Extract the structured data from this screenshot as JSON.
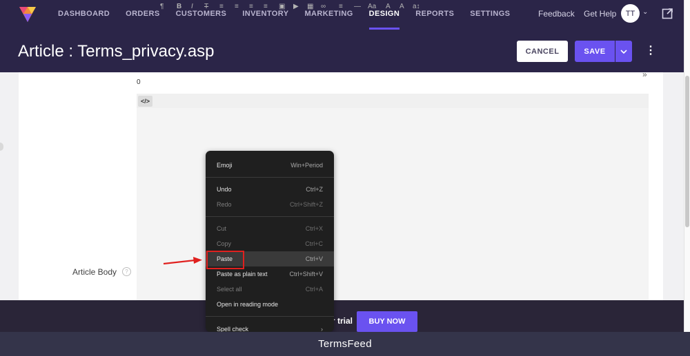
{
  "nav": {
    "items": [
      "DASHBOARD",
      "ORDERS",
      "CUSTOMERS",
      "INVENTORY",
      "MARKETING",
      "DESIGN",
      "REPORTS",
      "SETTINGS"
    ],
    "active": "DESIGN",
    "feedback": "Feedback",
    "get_help": "Get Help",
    "avatar_initials": "TT"
  },
  "header": {
    "title": "Article : Terms_privacy.asp",
    "cancel_label": "CANCEL",
    "save_label": "SAVE"
  },
  "editor": {
    "char_count": "0",
    "source_label": "</>",
    "article_body_label": "Article Body",
    "help_glyph": "?"
  },
  "context_menu": {
    "items": [
      {
        "label": "Emoji",
        "shortcut": "Win+Period",
        "enabled": true
      },
      {
        "label": "Undo",
        "shortcut": "Ctrl+Z",
        "enabled": true
      },
      {
        "label": "Redo",
        "shortcut": "Ctrl+Shift+Z",
        "enabled": false
      },
      {
        "label": "Cut",
        "shortcut": "Ctrl+X",
        "enabled": false
      },
      {
        "label": "Copy",
        "shortcut": "Ctrl+C",
        "enabled": false
      },
      {
        "label": "Paste",
        "shortcut": "Ctrl+V",
        "enabled": true,
        "highlighted": true
      },
      {
        "label": "Paste as plain text",
        "shortcut": "Ctrl+Shift+V",
        "enabled": true
      },
      {
        "label": "Select all",
        "shortcut": "Ctrl+A",
        "enabled": false
      },
      {
        "label": "Open in reading mode",
        "shortcut": "",
        "enabled": true
      },
      {
        "label": "Spell check",
        "shortcut": "›",
        "enabled": true
      }
    ]
  },
  "banner": {
    "text": "r trial",
    "buy_label": "BUY NOW"
  },
  "footer": {
    "brand": "TermsFeed"
  },
  "colors": {
    "topbar": "#2b2548",
    "accent": "#6a52f0",
    "annotation": "#e0201e"
  }
}
